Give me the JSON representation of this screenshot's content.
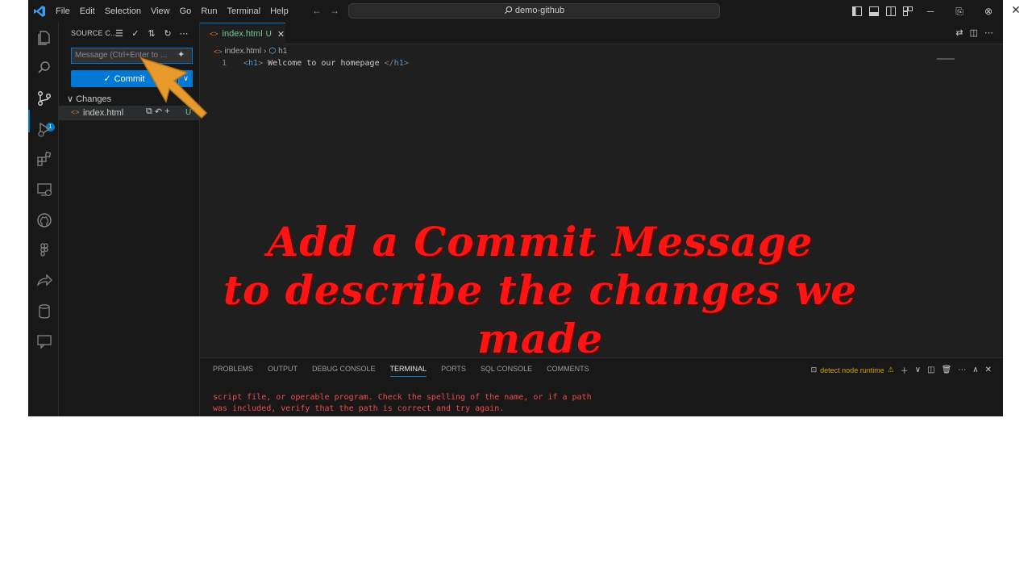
{
  "titlebar": {
    "menu": [
      "File",
      "Edit",
      "Selection",
      "View",
      "Go",
      "Run",
      "Terminal",
      "Help"
    ],
    "search_text": "demo-github"
  },
  "sidebar": {
    "title": "SOURCE C...",
    "message_placeholder": "Message (Ctrl+Enter to ...",
    "commit_label": "Commit",
    "changes_label": "Changes",
    "file_name": "index.html",
    "file_status": "U",
    "badge_count": "1"
  },
  "editor": {
    "tab_name": "index.html",
    "tab_status": "U",
    "breadcrumb_file": "index.html",
    "breadcrumb_symbol": "h1",
    "line_number": "1",
    "code_open": "<",
    "code_tag": "h1",
    "code_close": ">",
    "code_text": " Welcome to our homepage ",
    "code_end_open": "</",
    "code_end_tag": "h1",
    "code_end_close": ">"
  },
  "caption": {
    "line1": "Add a Commit Message",
    "line2": "to describe the changes we made"
  },
  "panel": {
    "tabs": [
      "PROBLEMS",
      "OUTPUT",
      "DEBUG CONSOLE",
      "TERMINAL",
      "PORTS",
      "SQL CONSOLE",
      "COMMENTS"
    ],
    "active_tab": "TERMINAL",
    "terminal_name": "detect node runtime",
    "output_line1": "script file, or operable program. Check the spelling of the name, or if a path",
    "output_line2": "was included, verify that the path is correct and try again."
  },
  "colors": {
    "accent": "#0078d4",
    "untracked": "#73c991",
    "caption": "#ff1414",
    "error": "#f14c4c",
    "arrow": "#e89a2c"
  }
}
